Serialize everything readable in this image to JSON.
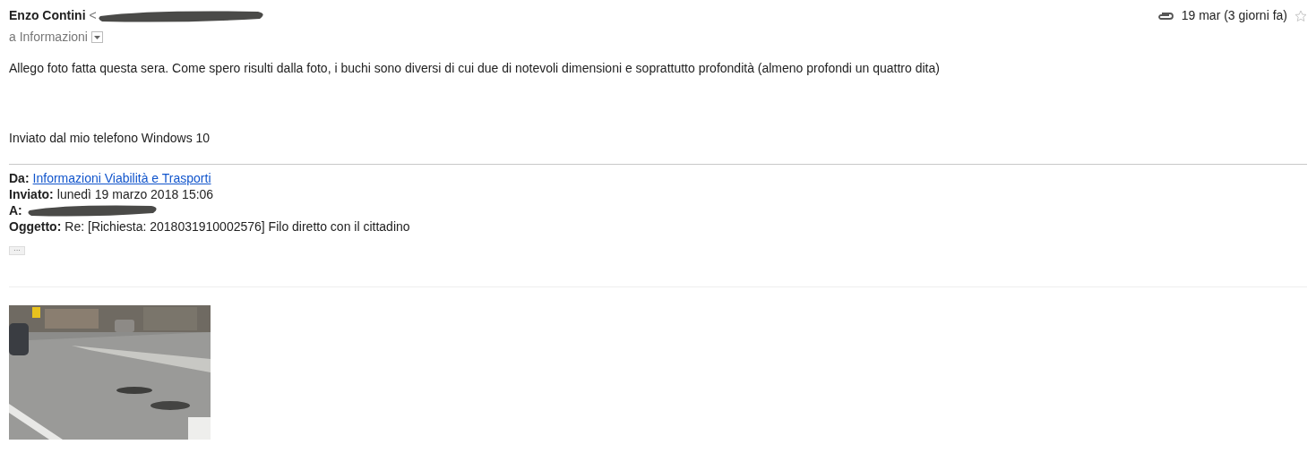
{
  "header": {
    "sender_name": "Enzo Contini",
    "sender_address": "<",
    "recipient": "a Informazioni",
    "date": "19 mar (3 giorni fa)",
    "starred": false
  },
  "body": {
    "paragraph": "Allego foto fatta questa sera. Come spero risulti dalla foto, i buchi sono diversi di cui due di notevoli dimensioni e soprattutto profondità (almeno profondi un quattro dita)",
    "signature": "Inviato dal mio telefono Windows 10"
  },
  "quoted_header": [
    {
      "label": "Da:",
      "value": "Informazioni Viabilità e Trasporti",
      "kind": "link"
    },
    {
      "label": "Inviato:",
      "value": "lunedì 19 marzo 2018 15:06",
      "kind": "text"
    },
    {
      "label": "A:",
      "kind": "redacted"
    },
    {
      "label": "Oggetto:",
      "value": "Re: [Richiesta: 2018031910002576] Filo diretto con il cittadino",
      "kind": "text"
    }
  ],
  "show_trimmed": "···"
}
